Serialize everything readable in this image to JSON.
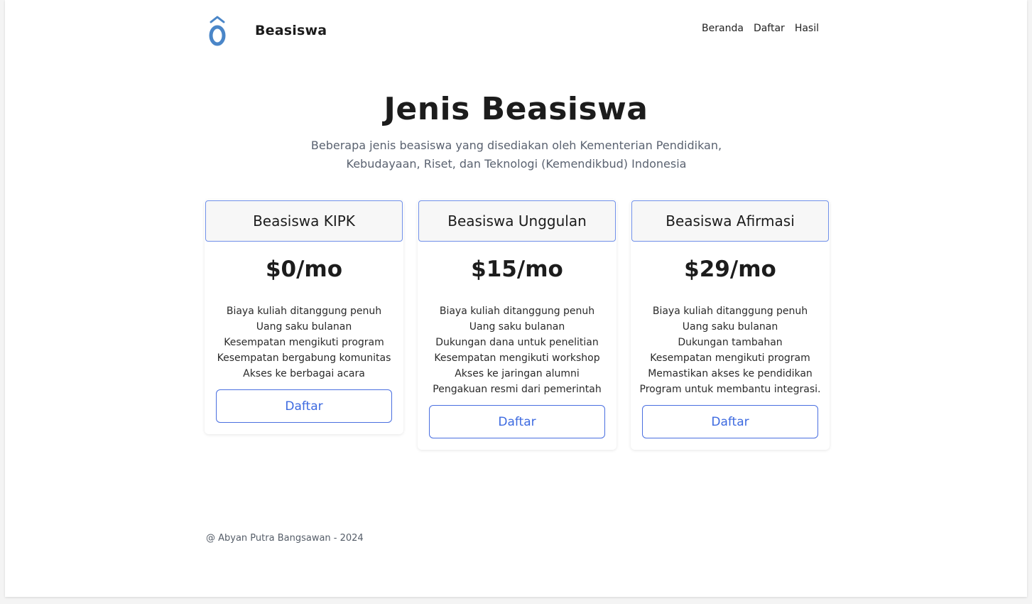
{
  "brand": {
    "name": "Beasiswa",
    "icon_color": "#4a86c8"
  },
  "nav": {
    "items": [
      "Beranda",
      "Daftar",
      "Hasil"
    ]
  },
  "hero": {
    "title": "Jenis Beasiswa",
    "subtitle": "Beberapa jenis beasiswa yang disediakan oleh Kementerian Pendidikan, Kebudayaan, Riset, dan Teknologi (Kemendikbud) Indonesia"
  },
  "cards": [
    {
      "title": "Beasiswa KIPK",
      "price": "$0/mo",
      "features": [
        "Biaya kuliah ditanggung penuh",
        "Uang saku bulanan",
        "Kesempatan mengikuti program",
        "Kesempatan bergabung komunitas",
        "Akses ke berbagai acara"
      ],
      "button": "Daftar"
    },
    {
      "title": "Beasiswa Unggulan",
      "price": "$15/mo",
      "features": [
        "Biaya kuliah ditanggung penuh",
        "Uang saku bulanan",
        "Dukungan dana untuk penelitian",
        "Kesempatan mengikuti workshop",
        "Akses ke jaringan alumni",
        "Pengakuan resmi dari pemerintah"
      ],
      "button": "Daftar"
    },
    {
      "title": "Beasiswa Afirmasi",
      "price": "$29/mo",
      "features": [
        "Biaya kuliah ditanggung penuh",
        "Uang saku bulanan",
        "Dukungan tambahan",
        "Kesempatan mengikuti program",
        "Memastikan akses ke pendidikan",
        "Program untuk membantu integrasi."
      ],
      "button": "Daftar"
    }
  ],
  "footer": {
    "text": "@ Abyan Putra Bangsawan - 2024"
  },
  "colors": {
    "accent": "#3d6ae0",
    "card_border": "#6f8fe8"
  }
}
